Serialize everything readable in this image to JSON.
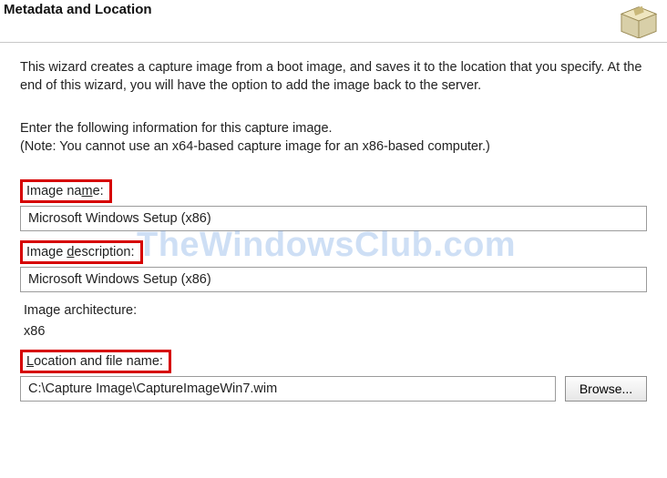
{
  "header": {
    "title": "Metadata and Location"
  },
  "intro": "This wizard creates a capture image from a boot image, and saves it to the location that you specify. At the end of this wizard, you will have the option to add the image back to the server.",
  "subintro_line1": "Enter the following information for this capture image.",
  "subintro_line2": "(Note: You cannot use an x64-based capture image for an x86-based computer.)",
  "fields": {
    "image_name": {
      "label_pre": "Image na",
      "label_ul": "m",
      "label_post": "e:",
      "value": "Microsoft Windows Setup (x86)"
    },
    "image_description": {
      "label_pre": "Image ",
      "label_ul": "d",
      "label_post": "escription:",
      "value": "Microsoft Windows Setup (x86)"
    },
    "image_architecture": {
      "label": "Image architecture:",
      "value": "x86"
    },
    "location": {
      "label_pre": "",
      "label_ul": "L",
      "label_post": "ocation and file name:",
      "value": "C:\\Capture Image\\CaptureImageWin7.wim"
    }
  },
  "buttons": {
    "browse": "Browse..."
  },
  "watermark": "TheWindowsClub.com"
}
